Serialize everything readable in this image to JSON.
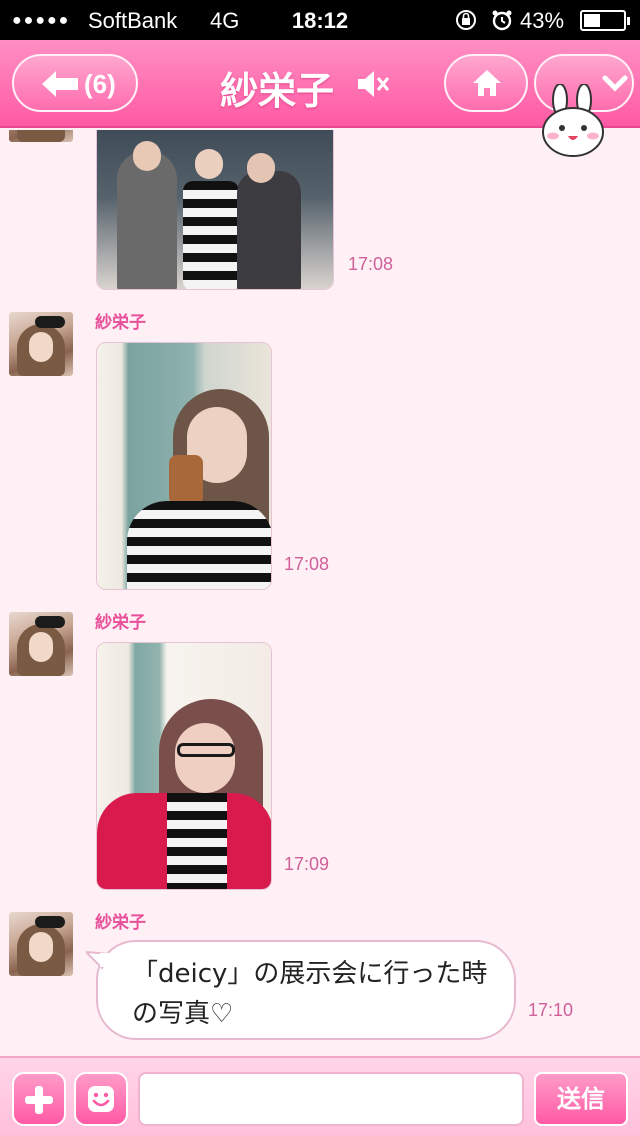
{
  "status_bar": {
    "signal_dots": "●●●●●",
    "carrier": "SoftBank",
    "network": "4G",
    "time": "18:12",
    "battery": "43%",
    "battery_level": 0.43
  },
  "header": {
    "unread_count": "(6)",
    "title": "紗栄子",
    "back_icon": "arrow-left-icon",
    "mute_icon": "speaker-muted-icon",
    "home_icon": "home-icon",
    "menu_icon": "chevron-down-icon",
    "character_icon": "bunny-character-icon"
  },
  "messages": [
    {
      "type": "photo",
      "time": "17:08"
    },
    {
      "type": "photo",
      "sender": "紗栄子",
      "time": "17:08"
    },
    {
      "type": "photo",
      "sender": "紗栄子",
      "time": "17:09"
    },
    {
      "type": "text",
      "sender": "紗栄子",
      "text": "「deicy」の展示会に行った時の写真♡",
      "time": "17:10"
    }
  ],
  "composer": {
    "input_value": "",
    "send_label": "送信",
    "plus_icon": "plus-icon",
    "emoji_icon": "smiley-icon"
  },
  "colors": {
    "accent": "#ff5aa5",
    "background": "#fff0f6",
    "sender_name": "#e8509a"
  }
}
